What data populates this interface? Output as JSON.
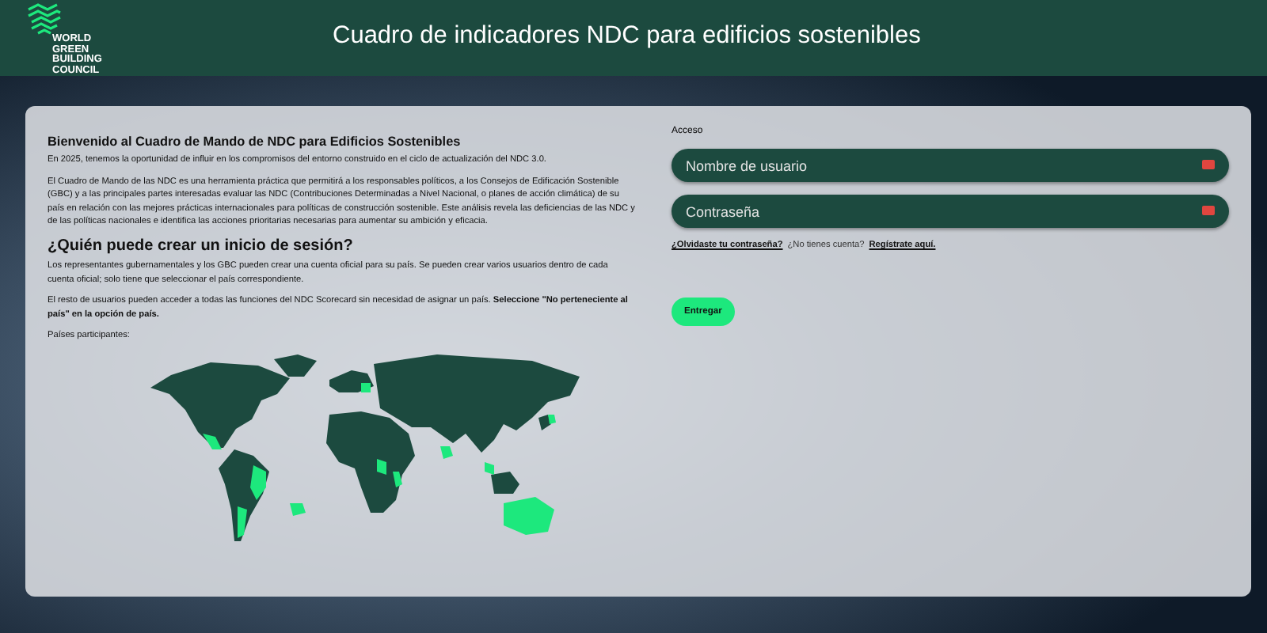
{
  "header": {
    "logo_text": [
      "WORLD",
      "GREEN",
      "BUILDING",
      "COUNCIL"
    ],
    "title": "Cuadro de indicadores NDC para edificios sostenibles"
  },
  "intro": {
    "heading": "Bienvenido al Cuadro de Mando de NDC para Edificios Sostenibles",
    "paragraphs": [
      "En 2025, tenemos la oportunidad de influir en los compromisos del entorno construido en el ciclo de actualización del NDC 3.0.",
      "El Cuadro de Mando de las NDC es una herramienta práctica que permitirá a los responsables políticos, a los Consejos de Edificación Sostenible (GBC) y a las principales partes interesadas evaluar las NDC (Contribuciones Determinadas a Nivel Nacional, o planes de acción climática) de su país en relación con las mejores prácticas internacionales para políticas de construcción sostenible. Este análisis revela las deficiencias de las NDC y de las políticas nacionales e identifica las acciones prioritarias necesarias para aumentar su ambición y eficacia."
    ],
    "subheading": "¿Quién puede crear un inicio de sesión?",
    "paragraphs_2": [
      "Los representantes gubernamentales y los GBC pueden crear una cuenta oficial para su país. Se pueden crear varios usuarios dentro de cada cuenta oficial; solo tiene que seleccionar el país correspondiente.",
      "El resto de usuarios pueden acceder a todas las funciones del NDC Scorecard sin necesidad de asignar un país. **Seleccione \"No perteneciente al país\" en la opción de país.**"
    ],
    "map_label": "Países participantes:"
  },
  "login": {
    "label": "Acceso",
    "fields": [
      {
        "placeholder": "Nombre de usuario",
        "invalid": true
      },
      {
        "placeholder": "Contraseña",
        "invalid": true
      }
    ],
    "links": [
      {
        "kind": "link",
        "text": "¿Olvidaste tu contraseña?"
      },
      {
        "kind": "text",
        "text": "¿No tienes cuenta?"
      },
      {
        "kind": "link",
        "text": "Regístrate aquí."
      }
    ],
    "submit": "Entregar"
  }
}
